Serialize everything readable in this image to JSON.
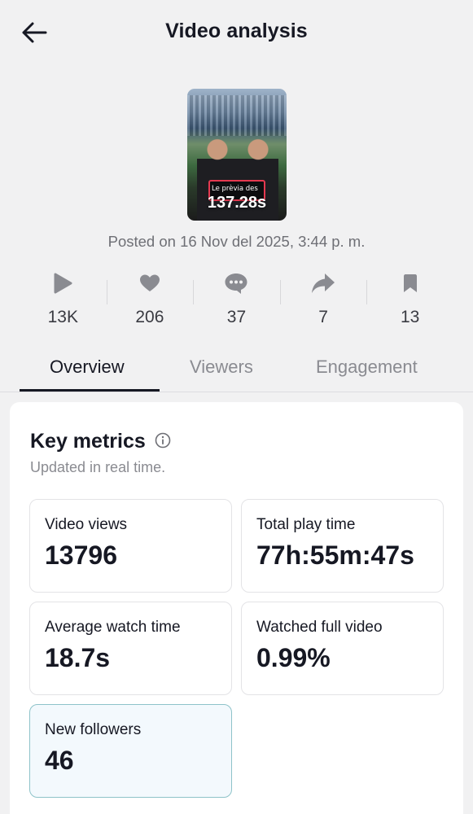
{
  "header": {
    "title": "Video analysis",
    "back_icon": "arrow-left-icon"
  },
  "video": {
    "thumbnail_caption": "Le prèvia des",
    "duration": "137.28s",
    "posted": "Posted on 16 Nov del 2025, 3:44 p. m."
  },
  "stats": [
    {
      "icon": "play-icon",
      "value": "13K"
    },
    {
      "icon": "heart-icon",
      "value": "206"
    },
    {
      "icon": "comment-icon",
      "value": "37"
    },
    {
      "icon": "share-icon",
      "value": "7"
    },
    {
      "icon": "bookmark-icon",
      "value": "13"
    }
  ],
  "tabs": [
    {
      "label": "Overview",
      "active": true
    },
    {
      "label": "Viewers",
      "active": false
    },
    {
      "label": "Engagement",
      "active": false
    }
  ],
  "key_metrics": {
    "title": "Key metrics",
    "subtitle": "Updated in real time.",
    "metrics": [
      {
        "label": "Video views",
        "value": "13796"
      },
      {
        "label": "Total play time",
        "value": "77h:55m:47s"
      },
      {
        "label": "Average watch time",
        "value": "18.7s"
      },
      {
        "label": "Watched full video",
        "value": "0.99%"
      },
      {
        "label": "New followers",
        "value": "46"
      }
    ]
  },
  "colors": {
    "background": "#f1f1f2",
    "text": "#161823",
    "muted": "#8a8b91",
    "icon": "#8a8b91",
    "highlight_bg": "#f3f9fd",
    "highlight_border": "#8ec3c9"
  }
}
